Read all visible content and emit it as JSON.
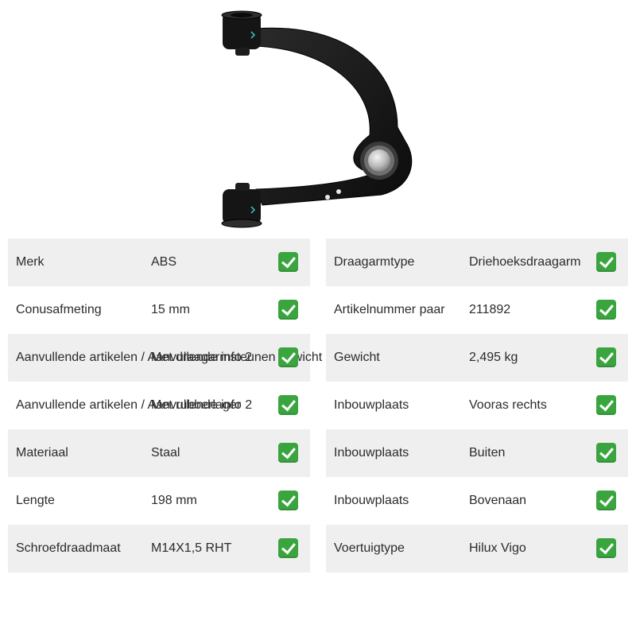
{
  "left_specs": [
    {
      "label": "Merk",
      "value": "ABS"
    },
    {
      "label": "Conusafmeting",
      "value": "15 mm"
    },
    {
      "label": "Aanvullende artikelen / Aanvullende info 2",
      "value": "Met draagarmsteunen gewicht"
    },
    {
      "label": "Aanvullende artikelen / Aanvullende info 2",
      "value": "Met rubberlager"
    },
    {
      "label": "Materiaal",
      "value": "Staal"
    },
    {
      "label": "Lengte",
      "value": "198 mm"
    },
    {
      "label": "Schroefdraadmaat",
      "value": "M14X1,5 RHT"
    }
  ],
  "right_specs": [
    {
      "label": "Draagarmtype",
      "value": "Driehoeksdraagarm"
    },
    {
      "label": "Artikelnummer paar",
      "value": "211892"
    },
    {
      "label": "Gewicht",
      "value": "2,495 kg"
    },
    {
      "label": "Inbouwplaats",
      "value": "Vooras rechts"
    },
    {
      "label": "Inbouwplaats",
      "value": "Buiten"
    },
    {
      "label": "Inbouwplaats",
      "value": "Bovenaan"
    },
    {
      "label": "Voertuigtype",
      "value": "Hilux Vigo"
    }
  ],
  "icons": {
    "check": "check-mark-icon"
  },
  "colors": {
    "row_shade": "#efefef",
    "check_green": "#3aa53f",
    "part_black": "#141414"
  }
}
